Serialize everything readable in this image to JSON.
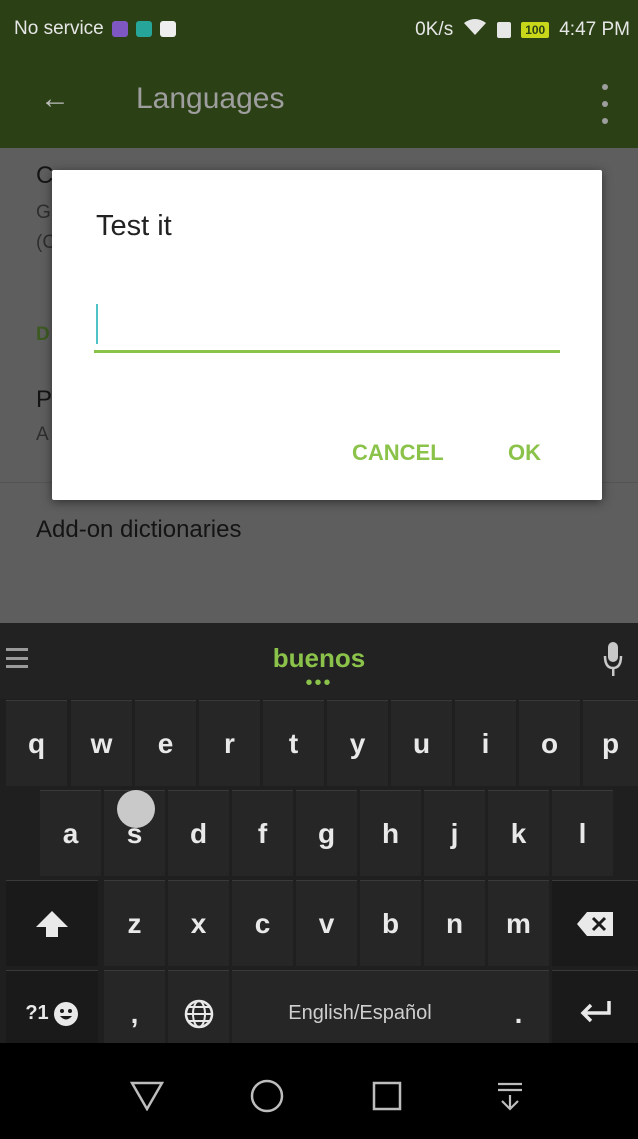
{
  "status_bar": {
    "carrier": "No service",
    "speed": "0K/s",
    "battery": "100",
    "time": "4:47 PM"
  },
  "app_bar": {
    "title": "Languages",
    "back_icon": "arrow-back-icon",
    "overflow_icon": "more-vert-icon"
  },
  "settings": {
    "items_visible_partial": [
      {
        "title_start": "C",
        "sub_start": "G",
        "sub2_start": "(C"
      },
      {
        "header_start": "D"
      },
      {
        "title_start": "P",
        "sub_start": "A"
      }
    ],
    "add_on": "Add-on dictionaries"
  },
  "dialog": {
    "title": "Test it",
    "input_value": "",
    "cancel_label": "CANCEL",
    "ok_label": "OK"
  },
  "keyboard": {
    "suggestion": "buenos",
    "more_dots": "•••",
    "row1": [
      "q",
      "w",
      "e",
      "r",
      "t",
      "y",
      "u",
      "i",
      "o",
      "p"
    ],
    "row2": [
      "a",
      "s",
      "d",
      "f",
      "g",
      "h",
      "j",
      "k",
      "l"
    ],
    "row3": [
      "z",
      "x",
      "c",
      "v",
      "b",
      "n",
      "m"
    ],
    "symbols_label": "?1",
    "comma": ",",
    "space_label": "English/Español",
    "period": ".",
    "accent_color": "#8bc34a"
  }
}
